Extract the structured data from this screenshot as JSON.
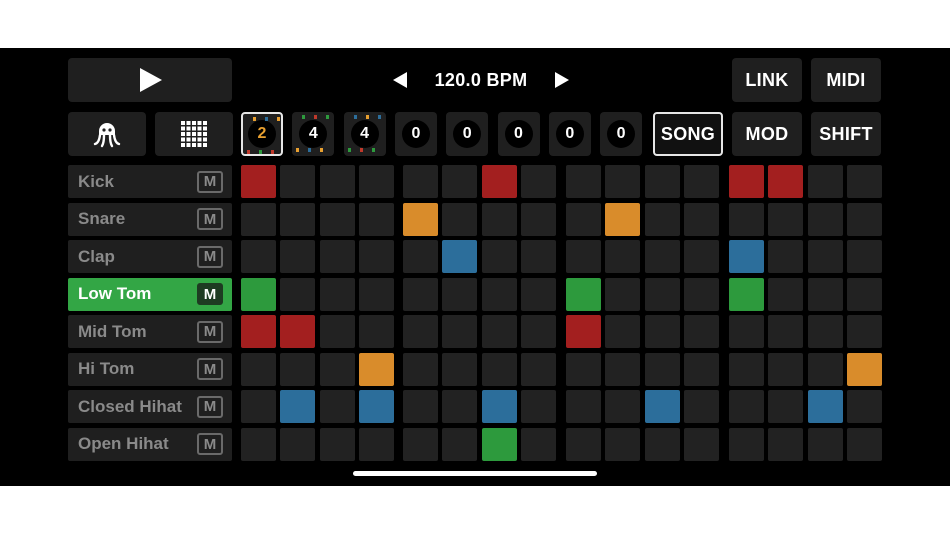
{
  "transport": {
    "play_icon": "play-icon",
    "bpm": "120.0 BPM",
    "prev_icon": "left-triangle-icon",
    "next_icon": "right-triangle-icon"
  },
  "buttons": {
    "link": "LINK",
    "midi": "MIDI",
    "song": "SONG",
    "mod": "MOD",
    "shift": "SHIFT"
  },
  "icons": {
    "logo": "octopus-icon",
    "grid": "grid-icon"
  },
  "patterns": [
    {
      "value": "2",
      "selected": true
    },
    {
      "value": "4",
      "selected": false
    },
    {
      "value": "4",
      "selected": false
    },
    {
      "value": "0",
      "selected": false
    },
    {
      "value": "0",
      "selected": false
    },
    {
      "value": "0",
      "selected": false
    },
    {
      "value": "0",
      "selected": false
    },
    {
      "value": "0",
      "selected": false
    }
  ],
  "tracks": [
    {
      "name": "Kick",
      "mute": "M",
      "active": false,
      "color": "red",
      "steps": [
        0,
        6,
        12,
        13
      ]
    },
    {
      "name": "Snare",
      "mute": "M",
      "active": false,
      "color": "orange",
      "steps": [
        4,
        9
      ]
    },
    {
      "name": "Clap",
      "mute": "M",
      "active": false,
      "color": "blue",
      "steps": [
        5,
        12
      ]
    },
    {
      "name": "Low Tom",
      "mute": "M",
      "active": true,
      "color": "green",
      "steps": [
        0,
        8,
        12
      ]
    },
    {
      "name": "Mid Tom",
      "mute": "M",
      "active": false,
      "color": "red",
      "steps": [
        0,
        1,
        8
      ]
    },
    {
      "name": "Hi Tom",
      "mute": "M",
      "active": false,
      "color": "orange",
      "steps": [
        3,
        15
      ]
    },
    {
      "name": "Closed Hihat",
      "mute": "M",
      "active": false,
      "color": "blue",
      "steps": [
        1,
        3,
        6,
        10,
        14
      ]
    },
    {
      "name": "Open Hihat",
      "mute": "M",
      "active": false,
      "color": "green",
      "steps": [
        6
      ]
    }
  ],
  "colors": {
    "red": "#a31f1f",
    "orange": "#d98c2b",
    "blue": "#2c6e9b",
    "green": "#2d9a3d",
    "accent": "#33a645"
  }
}
